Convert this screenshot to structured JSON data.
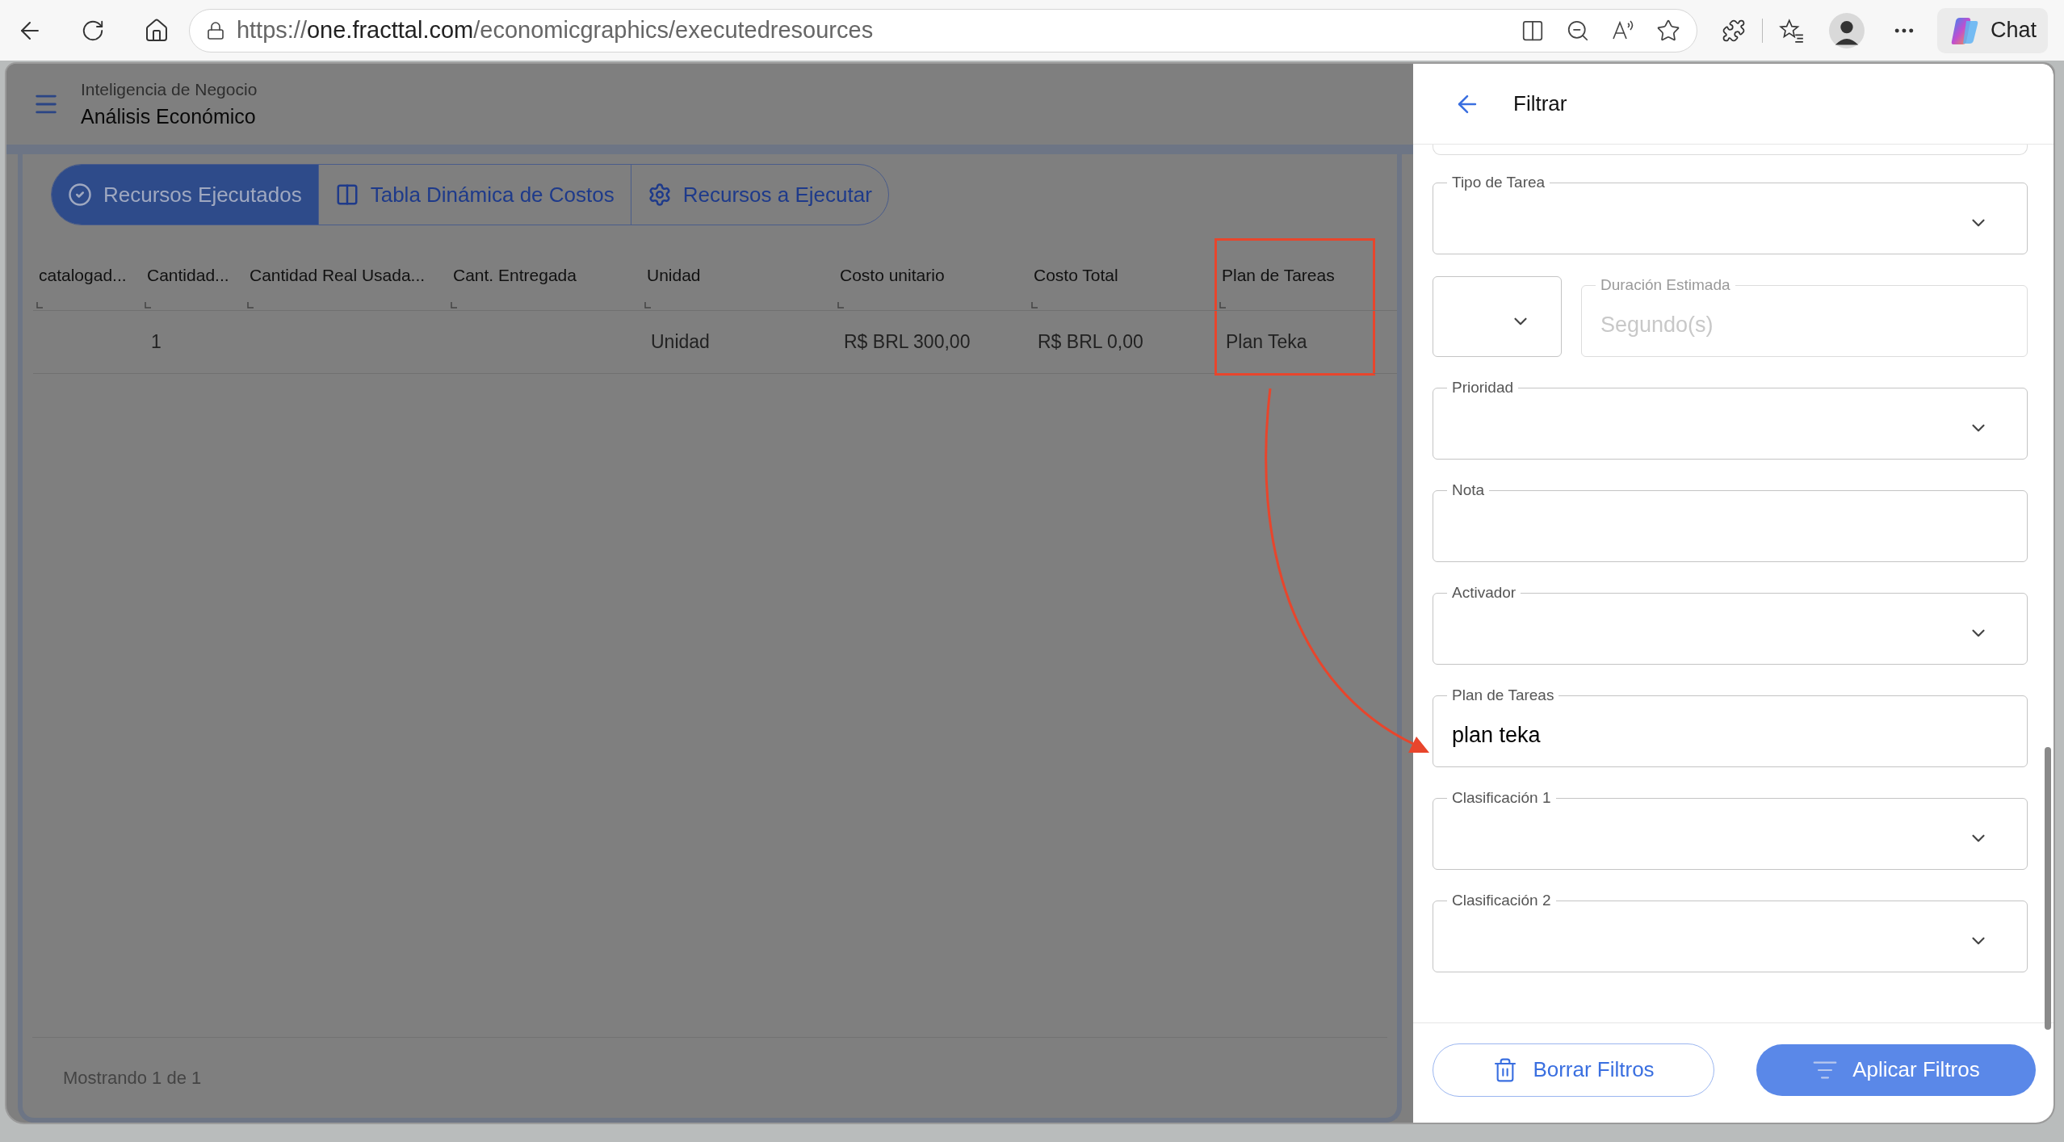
{
  "browser": {
    "url": {
      "scheme": "https://",
      "host": "one.fracttal.com",
      "path": "/economicgraphics/executedresources"
    },
    "chat_label": "Chat"
  },
  "app": {
    "breadcrumb": "Inteligencia de Negocio",
    "title": "Análisis Económico"
  },
  "tabs": [
    {
      "label": "Recursos Ejecutados",
      "selected": true
    },
    {
      "label": "Tabla Dinámica de Costos",
      "selected": false
    },
    {
      "label": "Recursos a Ejecutar",
      "selected": false
    }
  ],
  "table": {
    "columns": [
      {
        "label": "catalogad...",
        "highlighted": false
      },
      {
        "label": "Cantidad...",
        "highlighted": false
      },
      {
        "label": "Cantidad Real Usada...",
        "highlighted": false
      },
      {
        "label": "Cant. Entregada",
        "highlighted": false
      },
      {
        "label": "Unidad",
        "highlighted": false
      },
      {
        "label": "Costo unitario",
        "highlighted": false
      },
      {
        "label": "Costo Total",
        "highlighted": false
      },
      {
        "label": "Plan de Tareas",
        "highlighted": true
      }
    ],
    "rows": [
      {
        "cells": [
          null,
          "1",
          null,
          null,
          "Unidad",
          "R$ BRL 300,00",
          "R$ BRL 0,00",
          "Plan Teka"
        ]
      }
    ]
  },
  "status": "Mostrando 1 de 1",
  "filter_panel": {
    "title": "Filtrar",
    "fields": [
      {
        "kind": "select",
        "label": "Tipo de Tarea",
        "disabled": false
      },
      {
        "kind": "pair",
        "items": [
          {
            "kind": "select",
            "disabled": false
          },
          {
            "kind": "text",
            "label": "Duración Estimada",
            "placeholder": "Segundo(s)",
            "disabled": true
          }
        ]
      },
      {
        "kind": "select",
        "label": "Prioridad",
        "disabled": false
      },
      {
        "kind": "text",
        "label": "Nota",
        "disabled": false
      },
      {
        "kind": "select",
        "label": "Activador",
        "disabled": false
      },
      {
        "kind": "text",
        "label": "Plan de Tareas",
        "value": "plan teka",
        "disabled": false
      },
      {
        "kind": "select",
        "label": "Clasificación 1",
        "disabled": false
      },
      {
        "kind": "select",
        "label": "Clasificación 2",
        "disabled": false
      }
    ],
    "buttons": [
      {
        "kind": "outline",
        "label": "Borrar Filtros"
      },
      {
        "kind": "primary",
        "label": "Aplicar Filtros"
      }
    ]
  }
}
